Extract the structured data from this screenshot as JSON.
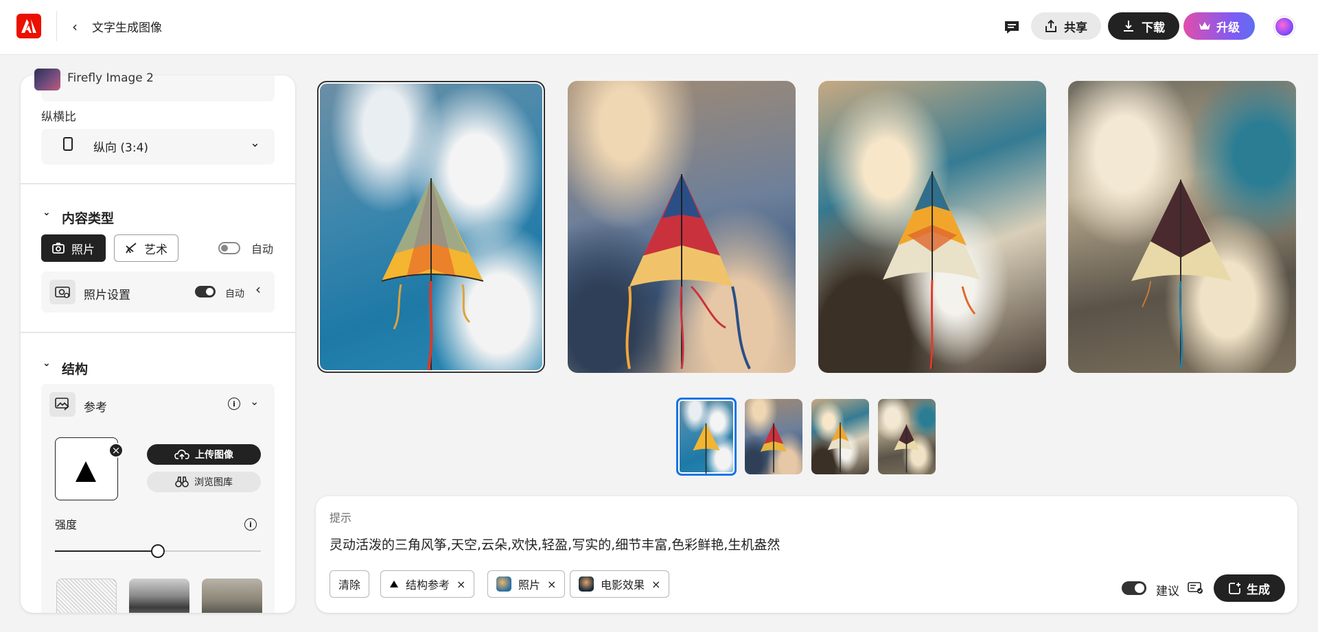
{
  "header": {
    "title": "文字生成图像",
    "share_label": "共享",
    "download_label": "下载",
    "upgrade_label": "升级",
    "logo_icon": "adobe-logo-icon",
    "comment_icon": "comment-icon",
    "accent_color": "#eb1000"
  },
  "sidebar": {
    "model_name": "Firefly Image 2",
    "aspect": {
      "label": "纵横比",
      "value": "纵向 (3:4)"
    },
    "content_type": {
      "title": "内容类型",
      "photo_label": "照片",
      "art_label": "艺术",
      "selected": "照片",
      "auto_label": "自动",
      "auto_enabled": false
    },
    "photo_settings": {
      "label": "照片设置",
      "auto_label": "自动",
      "auto_enabled": true
    },
    "structure": {
      "title": "结构",
      "reference_label": "参考",
      "upload_label": "上传图像",
      "browse_label": "浏览图库",
      "strength_label": "强度",
      "strength_value": 0.5
    }
  },
  "gallery": {
    "selected_index": 0,
    "images": [
      {
        "name": "kite-image-1"
      },
      {
        "name": "kite-image-2"
      },
      {
        "name": "kite-image-3"
      },
      {
        "name": "kite-image-4"
      }
    ]
  },
  "prompt": {
    "label": "提示",
    "text": "灵动活泼的三角风筝,天空,云朵,欢快,轻盈,写实的,细节丰富,色彩鲜艳,生机盎然",
    "clear_label": "清除",
    "chips": [
      {
        "label": "结构参考"
      },
      {
        "label": "照片"
      },
      {
        "label": "电影效果"
      }
    ],
    "suggestion_label": "建议",
    "suggestion_enabled": true,
    "generate_label": "生成"
  }
}
